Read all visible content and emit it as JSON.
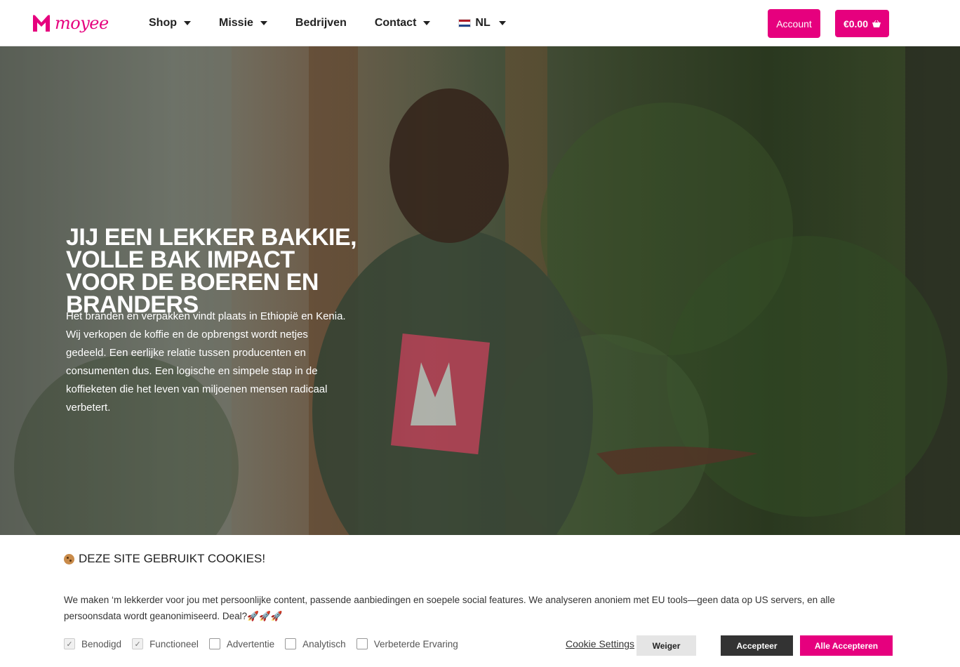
{
  "header": {
    "logo_text": "moyee",
    "nav": [
      {
        "label": "Shop",
        "has_dropdown": true
      },
      {
        "label": "Missie",
        "has_dropdown": true
      },
      {
        "label": "Bedrijven",
        "has_dropdown": false
      },
      {
        "label": "Contact",
        "has_dropdown": true
      },
      {
        "label": "NL",
        "has_dropdown": true,
        "icon": "netherlands-flag-icon"
      }
    ],
    "account_label": "Account",
    "cart_label": "€0.00",
    "cart_icon": "basket-icon"
  },
  "hero": {
    "title": "Jij een lekker bakkie, volle bak impact voor de boeren en branders",
    "text": "Het branden en verpakken vindt plaats in Ethiopië en Kenia. Wij verkopen de koffie en de opbrengst wordt netjes gedeeld. Een eerlijke relatie tussen producenten en consumenten dus. Een logische en simpele stap in de koffieketen die het leven van miljoenen mensen radicaal verbetert."
  },
  "cookie_banner": {
    "title": "Deze site gebruikt cookies!",
    "body": "We maken ‘m lekkerder voor jou met persoonlijke content, passende aanbiedingen en soepele social features. We analyseren anoniem met EU tools—geen data op US servers, en alle persoonsdata wordt geanonimiseerd. Deal?🚀🚀🚀",
    "checkboxes": [
      {
        "label": "Benodigd",
        "checked": true
      },
      {
        "label": "Functioneel",
        "checked": true
      },
      {
        "label": "Advertentie",
        "checked": false
      },
      {
        "label": "Analytisch",
        "checked": false
      },
      {
        "label": "Verbeterde Ervaring",
        "checked": false
      }
    ],
    "settings_label": "Cookie Settings",
    "deny_label": "Weiger",
    "accept_label": "Accepteer",
    "accept_all_label": "Alle Accepteren"
  },
  "colors": {
    "brand": "#e6007e",
    "dark_button": "#333333"
  }
}
